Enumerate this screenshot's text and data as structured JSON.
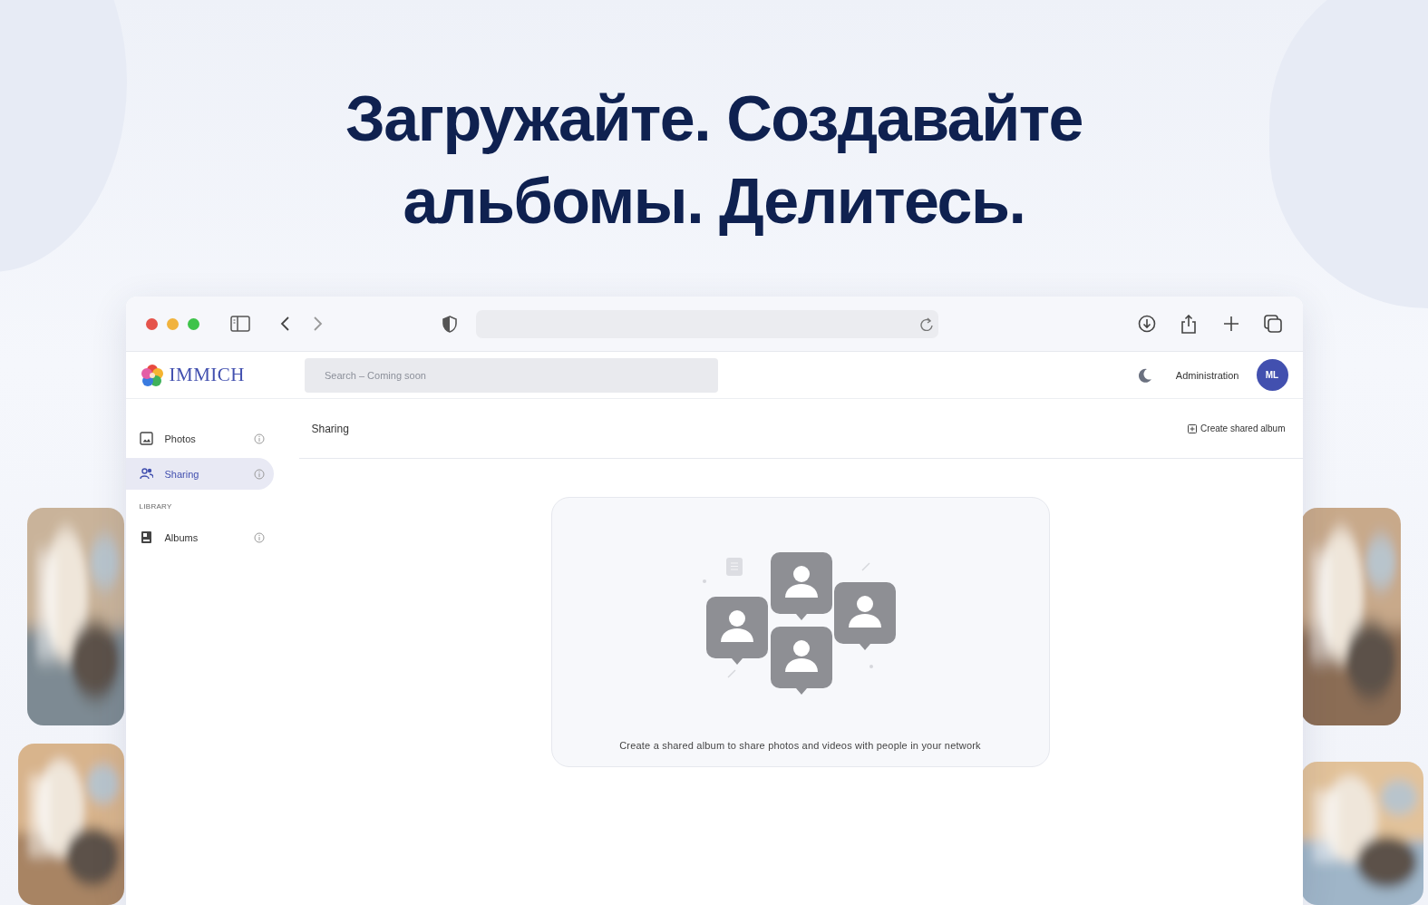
{
  "headline": {
    "lines": [
      "Загружайте. Создавайте",
      "альбомы. Делитесь."
    ]
  },
  "app": {
    "logo": "IMMICH",
    "search": {
      "placeholder": "Search – Coming soon"
    },
    "admin_link": "Administration",
    "avatar": "ML"
  },
  "sidebar": {
    "items": [
      {
        "label": "Photos",
        "selected": false
      },
      {
        "label": "Sharing",
        "selected": true
      }
    ],
    "sections": [
      {
        "label": "LIBRARY",
        "items": [
          {
            "label": "Albums",
            "selected": false
          }
        ]
      }
    ]
  },
  "main": {
    "title": "Sharing",
    "action": "Create shared album",
    "empty_message": "Create a shared album to share photos and videos with people in your network"
  }
}
